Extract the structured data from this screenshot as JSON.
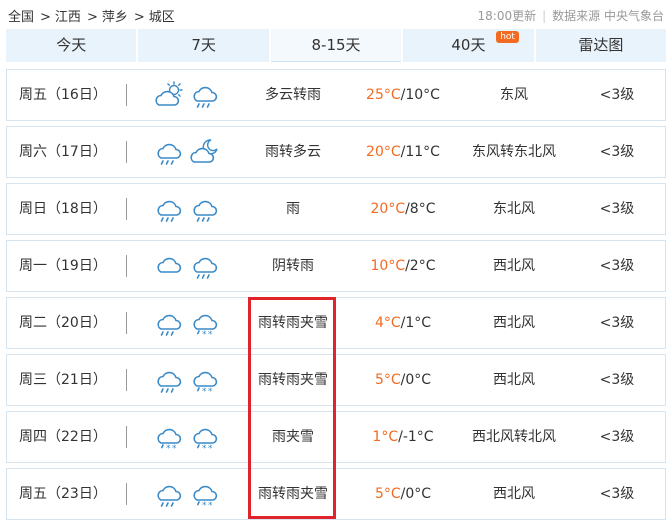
{
  "breadcrumb": [
    {
      "label": "全国"
    },
    {
      "label": "江西"
    },
    {
      "label": "萍乡"
    },
    {
      "label": "城区"
    }
  ],
  "breadcrumb_separator": ">",
  "header": {
    "update_time": "18:00更新",
    "divider": "|",
    "source_text": "数据来源 中央气象台"
  },
  "tabs": [
    {
      "label": "今天",
      "state": "inactive"
    },
    {
      "label": "7天",
      "state": "inactive"
    },
    {
      "label": "8-15天",
      "state": "active"
    },
    {
      "label": "40天",
      "state": "inactive",
      "badge": "hot"
    },
    {
      "label": "雷达图",
      "state": "inactive"
    }
  ],
  "forecast": [
    {
      "date": "周五（16日）",
      "icons": [
        "partly-cloudy-icon",
        "rain-icon"
      ],
      "condition": "多云转雨",
      "temp_high": "25°C",
      "temp_low": "/10°C",
      "wind": "东风",
      "level": "<3级"
    },
    {
      "date": "周六（17日）",
      "icons": [
        "rain-icon",
        "cloudy-night-icon"
      ],
      "condition": "雨转多云",
      "temp_high": "20°C",
      "temp_low": "/11°C",
      "wind": "东风转东北风",
      "level": "<3级"
    },
    {
      "date": "周日（18日）",
      "icons": [
        "rain-icon",
        "rain-icon"
      ],
      "condition": "雨",
      "temp_high": "20°C",
      "temp_low": "/8°C",
      "wind": "东北风",
      "level": "<3级"
    },
    {
      "date": "周一（19日）",
      "icons": [
        "cloud-icon",
        "rain-icon"
      ],
      "condition": "阴转雨",
      "temp_high": "10°C",
      "temp_low": "/2°C",
      "wind": "西北风",
      "level": "<3级"
    },
    {
      "date": "周二（20日）",
      "icons": [
        "rain-icon",
        "sleet-icon"
      ],
      "condition": "雨转雨夹雪",
      "temp_high": "4°C",
      "temp_low": "/1°C",
      "wind": "西北风",
      "level": "<3级"
    },
    {
      "date": "周三（21日）",
      "icons": [
        "rain-icon",
        "sleet-icon"
      ],
      "condition": "雨转雨夹雪",
      "temp_high": "5°C",
      "temp_low": "/0°C",
      "wind": "西北风",
      "level": "<3级"
    },
    {
      "date": "周四（22日）",
      "icons": [
        "sleet-icon",
        "sleet-icon"
      ],
      "condition": "雨夹雪",
      "temp_high": "1°C",
      "temp_low": "/-1°C",
      "wind": "西北风转北风",
      "level": "<3级"
    },
    {
      "date": "周五（23日）",
      "icons": [
        "rain-icon",
        "sleet-icon"
      ],
      "condition": "雨转雨夹雪",
      "temp_high": "5°C",
      "temp_low": "/0°C",
      "wind": "西北风",
      "level": "<3级"
    }
  ],
  "colors": {
    "high_temp": "#f26b21",
    "highlight_box": "#e0242b",
    "tab_bg": "#e8f3fb",
    "icon_stroke": "#3a8ac7"
  }
}
